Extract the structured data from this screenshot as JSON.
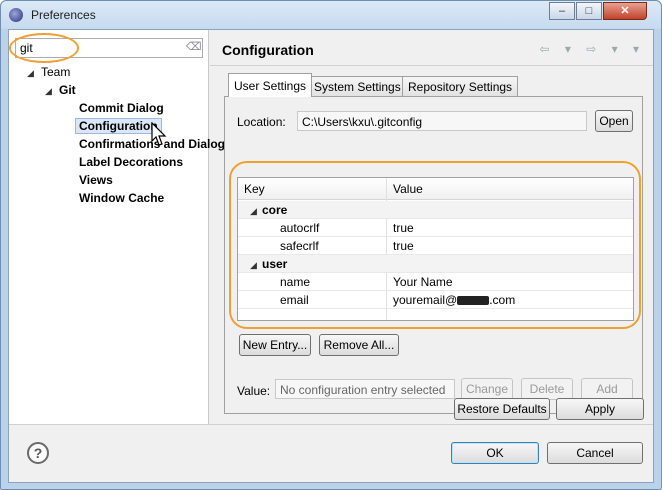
{
  "window": {
    "title": "Preferences",
    "controls": [
      "–",
      "□",
      "✕"
    ]
  },
  "filter": {
    "value": "git",
    "clear_icon": "⌫"
  },
  "tree": {
    "team": "Team",
    "git": "Git",
    "items": [
      "Commit Dialog",
      "Configuration",
      "Confirmations and Dialogs",
      "Label Decorations",
      "Views",
      "Window Cache"
    ],
    "selected": "Configuration"
  },
  "page": {
    "title": "Configuration",
    "nav": "⇦ ▾ ⇨ ▾ ▾"
  },
  "tabs": [
    "User Settings",
    "System Settings",
    "Repository Settings"
  ],
  "location": {
    "label": "Location:",
    "value": "C:\\Users\\kxu\\.gitconfig",
    "open_button": "Open"
  },
  "table": {
    "headers": [
      "Key",
      "Value"
    ],
    "rows": [
      {
        "key": "core",
        "value": ""
      },
      {
        "key": "autocrlf",
        "value": "true"
      },
      {
        "key": "safecrlf",
        "value": "true"
      },
      {
        "key": "user",
        "value": ""
      },
      {
        "key": "name",
        "value": "Your Name"
      },
      {
        "key": "email",
        "value_prefix": "youremail@",
        "value_suffix": ".com"
      }
    ]
  },
  "entry_buttons": {
    "new": "New Entry...",
    "remove": "Remove All..."
  },
  "value_row": {
    "label": "Value:",
    "placeholder": "No configuration entry selected",
    "change": "Change",
    "delete": "Delete",
    "add": "Add"
  },
  "page_buttons": {
    "restore": "Restore Defaults",
    "apply": "Apply"
  },
  "dialog_buttons": {
    "help": "?",
    "ok": "OK",
    "cancel": "Cancel"
  },
  "colors": {
    "highlight": "#f0a030",
    "selection": "#dbe7f7"
  }
}
